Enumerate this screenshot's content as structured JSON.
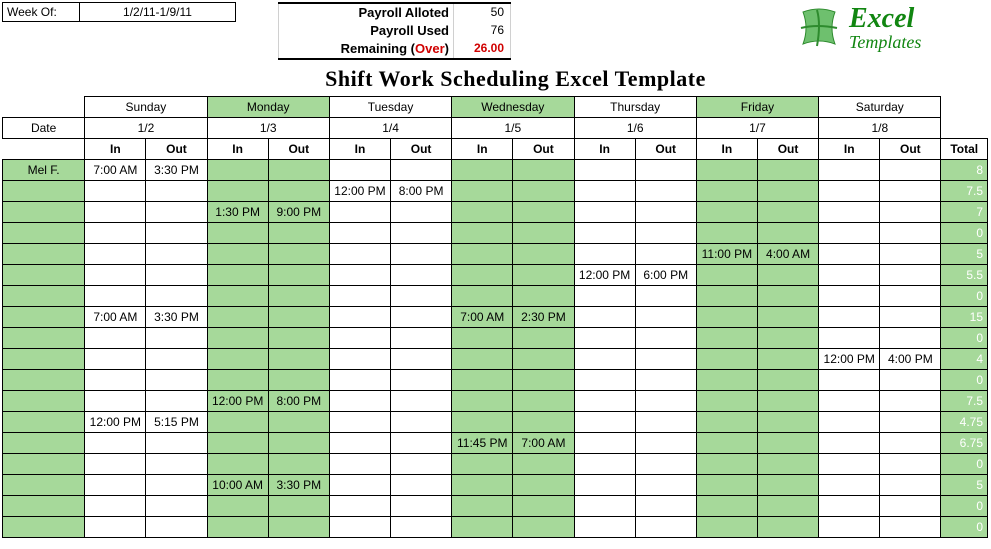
{
  "weekOf": {
    "label": "Week Of:",
    "value": "1/2/11-1/9/11"
  },
  "payroll": {
    "allottedLabel": "Payroll Alloted",
    "allottedValue": "50",
    "usedLabel": "Payroll Used",
    "usedValue": "76",
    "remainingLabel": "Remaining (",
    "overText": "Over",
    "remainingClose": ")",
    "remainingValue": "26.00"
  },
  "logo": {
    "line1": "Excel",
    "line2": "Templates"
  },
  "title": "Shift Work Scheduling Excel Template",
  "headers": {
    "dateLabel": "Date",
    "inLabel": "In",
    "outLabel": "Out",
    "totalLabel": "Total",
    "days": [
      {
        "name": "Sunday",
        "date": "1/2",
        "green": false
      },
      {
        "name": "Monday",
        "date": "1/3",
        "green": true
      },
      {
        "name": "Tuesday",
        "date": "1/4",
        "green": false
      },
      {
        "name": "Wednesday",
        "date": "1/5",
        "green": true
      },
      {
        "name": "Thursday",
        "date": "1/6",
        "green": false
      },
      {
        "name": "Friday",
        "date": "1/7",
        "green": true
      },
      {
        "name": "Saturday",
        "date": "1/8",
        "green": false
      }
    ]
  },
  "rows": [
    {
      "name": "Mel F.",
      "total": "8",
      "sun": [
        "7:00 AM",
        "3:30 PM"
      ],
      "mon": [
        "",
        ""
      ],
      "tue": [
        "",
        ""
      ],
      "wed": [
        "",
        ""
      ],
      "thu": [
        "",
        ""
      ],
      "fri": [
        "",
        ""
      ],
      "sat": [
        "",
        ""
      ]
    },
    {
      "name": "",
      "total": "7.5",
      "sun": [
        "",
        ""
      ],
      "mon": [
        "",
        ""
      ],
      "tue": [
        "12:00 PM",
        "8:00 PM"
      ],
      "wed": [
        "",
        ""
      ],
      "thu": [
        "",
        ""
      ],
      "fri": [
        "",
        ""
      ],
      "sat": [
        "",
        ""
      ]
    },
    {
      "name": "",
      "total": "7",
      "sun": [
        "",
        ""
      ],
      "mon": [
        "1:30 PM",
        "9:00 PM"
      ],
      "tue": [
        "",
        ""
      ],
      "wed": [
        "",
        ""
      ],
      "thu": [
        "",
        ""
      ],
      "fri": [
        "",
        ""
      ],
      "sat": [
        "",
        ""
      ]
    },
    {
      "name": "",
      "total": "0",
      "sun": [
        "",
        ""
      ],
      "mon": [
        "",
        ""
      ],
      "tue": [
        "",
        ""
      ],
      "wed": [
        "",
        ""
      ],
      "thu": [
        "",
        ""
      ],
      "fri": [
        "",
        ""
      ],
      "sat": [
        "",
        ""
      ]
    },
    {
      "name": "",
      "total": "5",
      "sun": [
        "",
        ""
      ],
      "mon": [
        "",
        ""
      ],
      "tue": [
        "",
        ""
      ],
      "wed": [
        "",
        ""
      ],
      "thu": [
        "",
        ""
      ],
      "fri": [
        "11:00 PM",
        "4:00 AM"
      ],
      "sat": [
        "",
        ""
      ]
    },
    {
      "name": "",
      "total": "5.5",
      "sun": [
        "",
        ""
      ],
      "mon": [
        "",
        ""
      ],
      "tue": [
        "",
        ""
      ],
      "wed": [
        "",
        ""
      ],
      "thu": [
        "12:00 PM",
        "6:00 PM"
      ],
      "fri": [
        "",
        ""
      ],
      "sat": [
        "",
        ""
      ]
    },
    {
      "name": "",
      "total": "0",
      "sun": [
        "",
        ""
      ],
      "mon": [
        "",
        ""
      ],
      "tue": [
        "",
        ""
      ],
      "wed": [
        "",
        ""
      ],
      "thu": [
        "",
        ""
      ],
      "fri": [
        "",
        ""
      ],
      "sat": [
        "",
        ""
      ]
    },
    {
      "name": "",
      "total": "15",
      "sun": [
        "7:00 AM",
        "3:30 PM"
      ],
      "mon": [
        "",
        ""
      ],
      "tue": [
        "",
        ""
      ],
      "wed": [
        "7:00 AM",
        "2:30 PM"
      ],
      "thu": [
        "",
        ""
      ],
      "fri": [
        "",
        ""
      ],
      "sat": [
        "",
        ""
      ]
    },
    {
      "name": "",
      "total": "0",
      "sun": [
        "",
        ""
      ],
      "mon": [
        "",
        ""
      ],
      "tue": [
        "",
        ""
      ],
      "wed": [
        "",
        ""
      ],
      "thu": [
        "",
        ""
      ],
      "fri": [
        "",
        ""
      ],
      "sat": [
        "",
        ""
      ]
    },
    {
      "name": "",
      "total": "4",
      "sun": [
        "",
        ""
      ],
      "mon": [
        "",
        ""
      ],
      "tue": [
        "",
        ""
      ],
      "wed": [
        "",
        ""
      ],
      "thu": [
        "",
        ""
      ],
      "fri": [
        "",
        ""
      ],
      "sat": [
        "12:00 PM",
        "4:00 PM"
      ]
    },
    {
      "name": "",
      "total": "0",
      "sun": [
        "",
        ""
      ],
      "mon": [
        "",
        ""
      ],
      "tue": [
        "",
        ""
      ],
      "wed": [
        "",
        ""
      ],
      "thu": [
        "",
        ""
      ],
      "fri": [
        "",
        ""
      ],
      "sat": [
        "",
        ""
      ]
    },
    {
      "name": "",
      "total": "7.5",
      "sun": [
        "",
        ""
      ],
      "mon": [
        "12:00 PM",
        "8:00 PM"
      ],
      "tue": [
        "",
        ""
      ],
      "wed": [
        "",
        ""
      ],
      "thu": [
        "",
        ""
      ],
      "fri": [
        "",
        ""
      ],
      "sat": [
        "",
        ""
      ]
    },
    {
      "name": "",
      "total": "4.75",
      "sun": [
        "12:00 PM",
        "5:15 PM"
      ],
      "mon": [
        "",
        ""
      ],
      "tue": [
        "",
        ""
      ],
      "wed": [
        "",
        ""
      ],
      "thu": [
        "",
        ""
      ],
      "fri": [
        "",
        ""
      ],
      "sat": [
        "",
        ""
      ]
    },
    {
      "name": "",
      "total": "6.75",
      "sun": [
        "",
        ""
      ],
      "mon": [
        "",
        ""
      ],
      "tue": [
        "",
        ""
      ],
      "wed": [
        "11:45 PM",
        "7:00 AM"
      ],
      "thu": [
        "",
        ""
      ],
      "fri": [
        "",
        ""
      ],
      "sat": [
        "",
        ""
      ]
    },
    {
      "name": "",
      "total": "0",
      "sun": [
        "",
        ""
      ],
      "mon": [
        "",
        ""
      ],
      "tue": [
        "",
        ""
      ],
      "wed": [
        "",
        ""
      ],
      "thu": [
        "",
        ""
      ],
      "fri": [
        "",
        ""
      ],
      "sat": [
        "",
        ""
      ]
    },
    {
      "name": "",
      "total": "5",
      "sun": [
        "",
        ""
      ],
      "mon": [
        "10:00 AM",
        "3:30 PM"
      ],
      "tue": [
        "",
        ""
      ],
      "wed": [
        "",
        ""
      ],
      "thu": [
        "",
        ""
      ],
      "fri": [
        "",
        ""
      ],
      "sat": [
        "",
        ""
      ]
    },
    {
      "name": "",
      "total": "0",
      "sun": [
        "",
        ""
      ],
      "mon": [
        "",
        ""
      ],
      "tue": [
        "",
        ""
      ],
      "wed": [
        "",
        ""
      ],
      "thu": [
        "",
        ""
      ],
      "fri": [
        "",
        ""
      ],
      "sat": [
        "",
        ""
      ]
    },
    {
      "name": "",
      "total": "0",
      "sun": [
        "",
        ""
      ],
      "mon": [
        "",
        ""
      ],
      "tue": [
        "",
        ""
      ],
      "wed": [
        "",
        ""
      ],
      "thu": [
        "",
        ""
      ],
      "fri": [
        "",
        ""
      ],
      "sat": [
        "",
        ""
      ]
    }
  ]
}
